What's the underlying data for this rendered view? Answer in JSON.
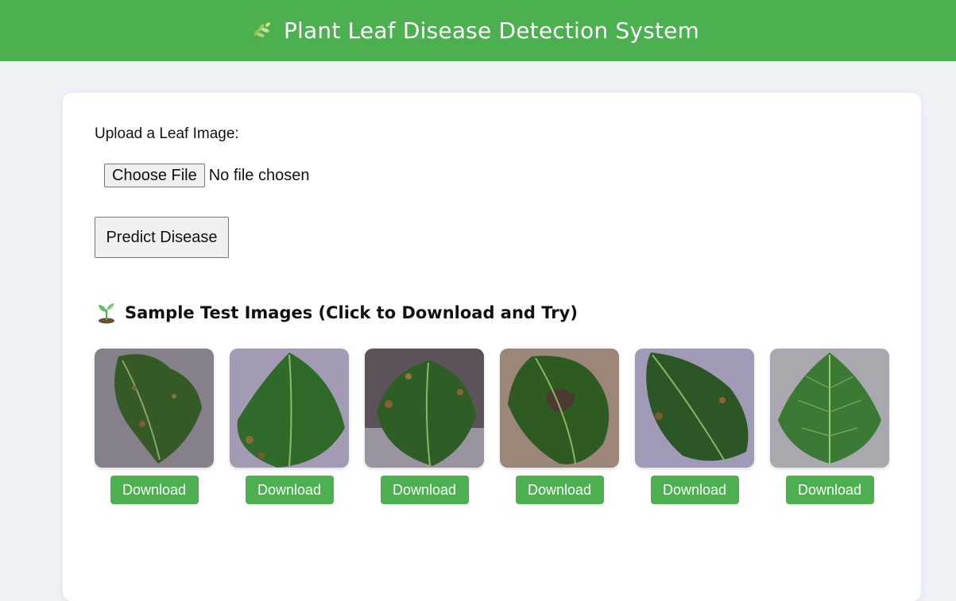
{
  "header": {
    "title": "Plant Leaf Disease Detection System",
    "icon": "herb-icon"
  },
  "upload": {
    "label": "Upload a Leaf Image:",
    "choose_button": "Choose File",
    "status": "No file chosen"
  },
  "predict": {
    "label": "Predict Disease"
  },
  "samples": {
    "title": "Sample Test Images (Click to Download and Try)",
    "icon": "seedling-icon",
    "items": [
      {
        "download_label": "Download",
        "condition": "diseased",
        "background": "#8a8490"
      },
      {
        "download_label": "Download",
        "condition": "diseased",
        "background": "#a49cb4"
      },
      {
        "download_label": "Download",
        "condition": "diseased",
        "background": "#5a4e56"
      },
      {
        "download_label": "Download",
        "condition": "diseased",
        "background": "#9a8478"
      },
      {
        "download_label": "Download",
        "condition": "diseased",
        "background": "#a09ab6"
      },
      {
        "download_label": "Download",
        "condition": "healthy",
        "background": "#a8a8ae"
      }
    ]
  },
  "colors": {
    "header_green": "#4caf50",
    "button_green": "#4caf50",
    "page_background": "#eef2f6"
  }
}
